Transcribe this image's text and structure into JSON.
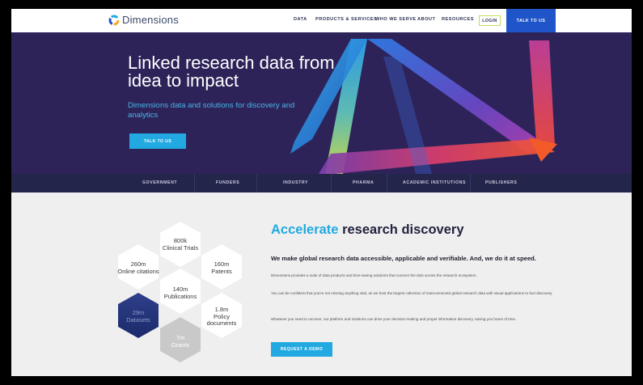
{
  "header": {
    "logo_text": "Dimensions",
    "nav": [
      "DATA",
      "PRODUCTS & SERVICES",
      "WHO WE SERVE",
      "ABOUT",
      "RESOURCES"
    ],
    "login_label": "LOGIN",
    "talk_label": "TALK TO US"
  },
  "hero": {
    "title": "Linked research data from idea to impact",
    "subtitle": "Dimensions data and solutions for discovery and analytics",
    "cta_label": "TALK TO US"
  },
  "audiences": [
    "GOVERNMENT",
    "FUNDERS",
    "INDUSTRY",
    "PHARMA",
    "ACADEMIC INSTITUTIONS",
    "PUBLISHERS"
  ],
  "stats": [
    {
      "value": "800k",
      "label": "Clinical Trials"
    },
    {
      "value": "260m",
      "label": "Online citations"
    },
    {
      "value": "160m",
      "label": "Patents"
    },
    {
      "value": "140m",
      "label": "Publications"
    },
    {
      "value": "29m",
      "label": "Datasets"
    },
    {
      "value": "1.8m",
      "label": "Policy documents"
    },
    {
      "value": "7m",
      "label": "Grants"
    }
  ],
  "section": {
    "heading_accent": "Accelerate",
    "heading_rest": " research discovery",
    "lead": "We make global research data accessible, applicable and verifiable. And, we do it at speed.",
    "p1": "Dimensions provides a suite of data products and time-saving solutions that connect the dots across the research ecosystem.",
    "p2": "You can be confident that you're not missing anything vital, as we host the largest collection of interconnected global research data with visual applications to fuel discovery.",
    "p3": "Whatever you need to uncover, our platform and solutions can drive your decision-making and propel information discovery, saving you hours of time.",
    "demo_label": "REQUEST A DEMO"
  },
  "colors": {
    "hero_bg": "#2d2359",
    "accent_blue": "#22a9e1",
    "brand_blue": "#1f55c8",
    "audience_bg": "#23254a"
  }
}
